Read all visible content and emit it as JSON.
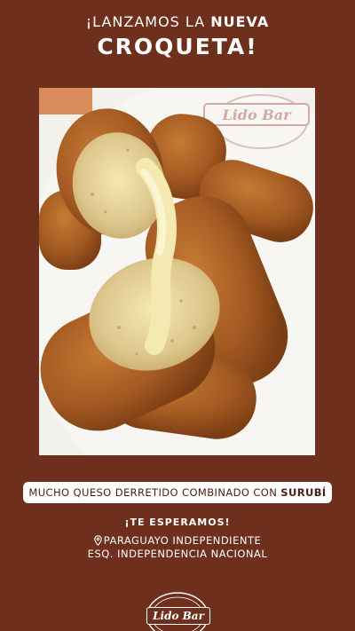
{
  "headline": {
    "line1_prefix": "¡LANZAMOS LA ",
    "line1_bold": "NUEVA",
    "line2": "CROQUETA!"
  },
  "photo": {
    "logo_watermark": "Lido Bar"
  },
  "pill": {
    "text_prefix": "MUCHO QUESO DERRETIDO COMBINADO CON ",
    "text_bold": "SURUBÍ"
  },
  "invite": "¡TE ESPERAMOS!",
  "address": {
    "line1": "PARAGUAYO INDEPENDIENTE",
    "line2": "ESQ. INDEPENDENCIA NACIONAL",
    "icon": "location-pin-icon"
  },
  "logo": {
    "text": "Lido Bar"
  },
  "colors": {
    "background": "#6e2f1c",
    "text": "#ffffff",
    "pill_text": "#4a2116"
  }
}
